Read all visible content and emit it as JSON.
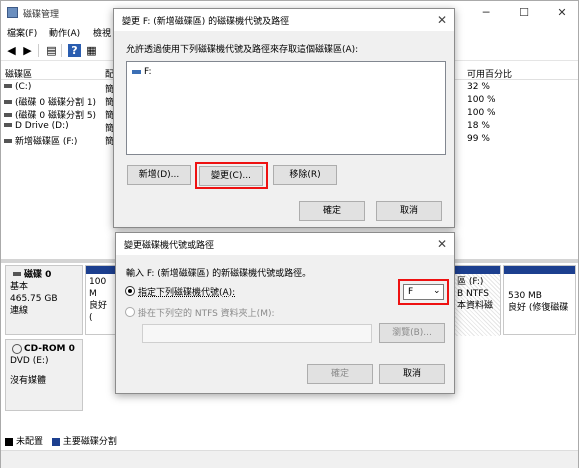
{
  "window": {
    "title": "磁碟管理",
    "min": "─",
    "max": "☐",
    "close": "✕"
  },
  "menu": [
    "檔案(F)",
    "動作(A)",
    "檢視"
  ],
  "volumes": {
    "header_left": "磁碟區",
    "header_mid": "配",
    "header_right": "可用百分比",
    "rows": [
      {
        "name": "(C:)",
        "col2": "簡",
        "pct": "32 %"
      },
      {
        "name": "(磁碟 0 磁碟分割 1)",
        "col2": "簡",
        "pct": "100 %"
      },
      {
        "name": "(磁碟 0 磁碟分割 5)",
        "col2": "簡",
        "pct": "100 %"
      },
      {
        "name": "D Drive (D:)",
        "col2": "簡",
        "pct": "18 %"
      },
      {
        "name": "新增磁碟區 (F:)",
        "col2": "簡",
        "pct": "99 %"
      }
    ]
  },
  "disk0": {
    "name": "磁碟 0",
    "type": "基本",
    "size": "465.75 GB",
    "status": "連線",
    "part_left_size": "100 M",
    "part_left_status": "良好 (",
    "part_f_name": "區 (F:)",
    "part_f_fs": "B NTFS",
    "part_f_status": "本資料磁",
    "part_right_size": "530 MB",
    "part_right_status": "良好 (修復磁碟"
  },
  "cdrom": {
    "name": "CD-ROM 0",
    "dev": "DVD (E:)",
    "media": "沒有媒體"
  },
  "legend": {
    "unallocated": "未配置",
    "primary": "主要磁碟分割"
  },
  "colors": {
    "accent_red": "#e11111",
    "partition_blue": "#1c3f8f"
  },
  "dialog1": {
    "title": "變更 F: (新增磁碟區) 的磁碟機代號及路徑",
    "desc": "允許透過使用下列磁碟機代號及路徑來存取這個磁碟區(A):",
    "list_item": "F:",
    "btn_add": "新增(D)...",
    "btn_change": "變更(C)...",
    "btn_remove": "移除(R)",
    "btn_ok": "確定",
    "btn_cancel": "取消",
    "close": "✕"
  },
  "dialog2": {
    "title": "變更磁碟機代號或路徑",
    "desc": "輸入 F: (新增磁碟區) 的新磁碟機代號或路徑。",
    "radio1": "指定下列磁碟機代號(A):",
    "radio2": "掛在下列空的 NTFS 資料夾上(M):",
    "drive_value": "F",
    "browse": "瀏覽(B)...",
    "btn_ok": "確定",
    "btn_cancel": "取消",
    "close": "✕"
  }
}
